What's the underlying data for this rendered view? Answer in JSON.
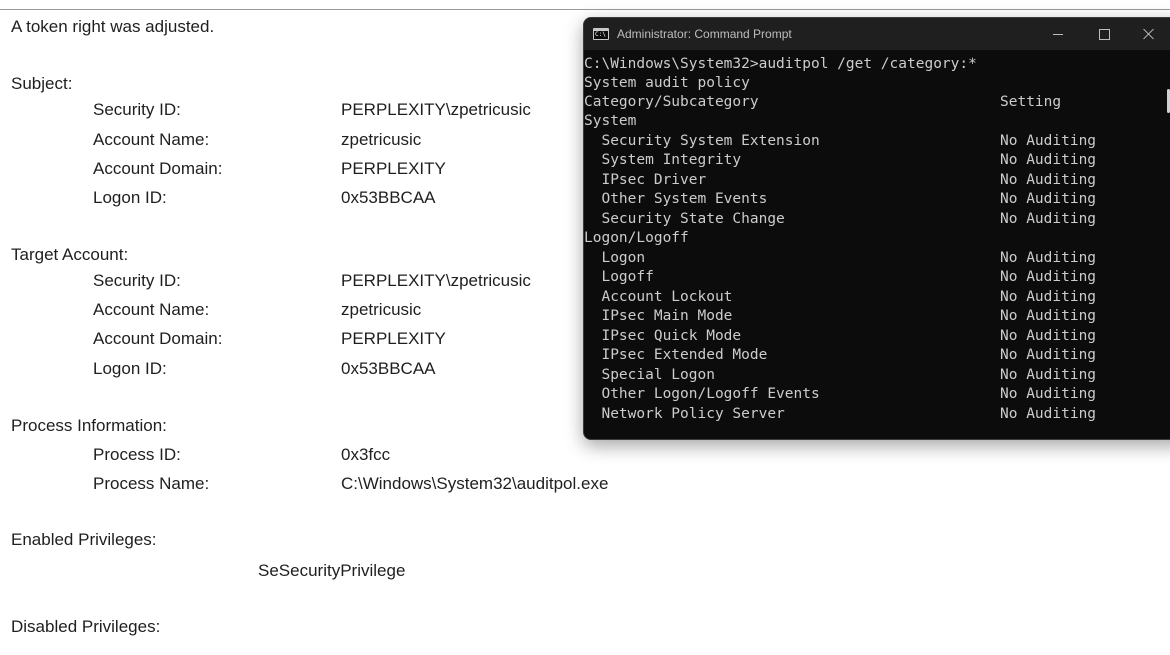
{
  "event": {
    "header": "A token right was adjusted.",
    "subject": {
      "heading": "Subject:",
      "rows": [
        {
          "label": "Security ID:",
          "value": "PERPLEXITY\\zpetricusic"
        },
        {
          "label": "Account Name:",
          "value": "zpetricusic"
        },
        {
          "label": "Account Domain:",
          "value": "PERPLEXITY"
        },
        {
          "label": "Logon ID:",
          "value": "0x53BBCAA"
        }
      ]
    },
    "target": {
      "heading": "Target Account:",
      "rows": [
        {
          "label": "Security ID:",
          "value": "PERPLEXITY\\zpetricusic"
        },
        {
          "label": "Account Name:",
          "value": "zpetricusic"
        },
        {
          "label": "Account Domain:",
          "value": "PERPLEXITY"
        },
        {
          "label": "Logon ID:",
          "value": "0x53BBCAA"
        }
      ]
    },
    "process": {
      "heading": "Process Information:",
      "rows": [
        {
          "label": "Process ID:",
          "value": "0x3fcc"
        },
        {
          "label": "Process Name:",
          "value": "C:\\Windows\\System32\\auditpol.exe"
        }
      ]
    },
    "enabled": {
      "heading": "Enabled Privileges:",
      "value": "SeSecurityPrivilege"
    },
    "disabled": {
      "heading": "Disabled Privileges:"
    }
  },
  "cmd": {
    "title": "Administrator: Command Prompt",
    "icon": "cmd-app-icon",
    "icon_text": "C:\\",
    "colors": {
      "background": "#0c0c0c",
      "titlebar": "#1f1f1f",
      "text": "#cccccc"
    },
    "lines": [
      {
        "text": "C:\\Windows\\System32>auditpol /get /category:*",
        "setting": ""
      },
      {
        "text": "System audit policy",
        "setting": ""
      },
      {
        "text": "Category/Subcategory",
        "setting": "Setting"
      },
      {
        "text": "System",
        "setting": ""
      },
      {
        "text": "  Security System Extension",
        "setting": "No Auditing"
      },
      {
        "text": "  System Integrity",
        "setting": "No Auditing"
      },
      {
        "text": "  IPsec Driver",
        "setting": "No Auditing"
      },
      {
        "text": "  Other System Events",
        "setting": "No Auditing"
      },
      {
        "text": "  Security State Change",
        "setting": "No Auditing"
      },
      {
        "text": "Logon/Logoff",
        "setting": ""
      },
      {
        "text": "  Logon",
        "setting": "No Auditing"
      },
      {
        "text": "  Logoff",
        "setting": "No Auditing"
      },
      {
        "text": "  Account Lockout",
        "setting": "No Auditing"
      },
      {
        "text": "  IPsec Main Mode",
        "setting": "No Auditing"
      },
      {
        "text": "  IPsec Quick Mode",
        "setting": "No Auditing"
      },
      {
        "text": "  IPsec Extended Mode",
        "setting": "No Auditing"
      },
      {
        "text": "  Special Logon",
        "setting": "No Auditing"
      },
      {
        "text": "  Other Logon/Logoff Events",
        "setting": "No Auditing"
      },
      {
        "text": "  Network Policy Server",
        "setting": "No Auditing"
      }
    ]
  }
}
